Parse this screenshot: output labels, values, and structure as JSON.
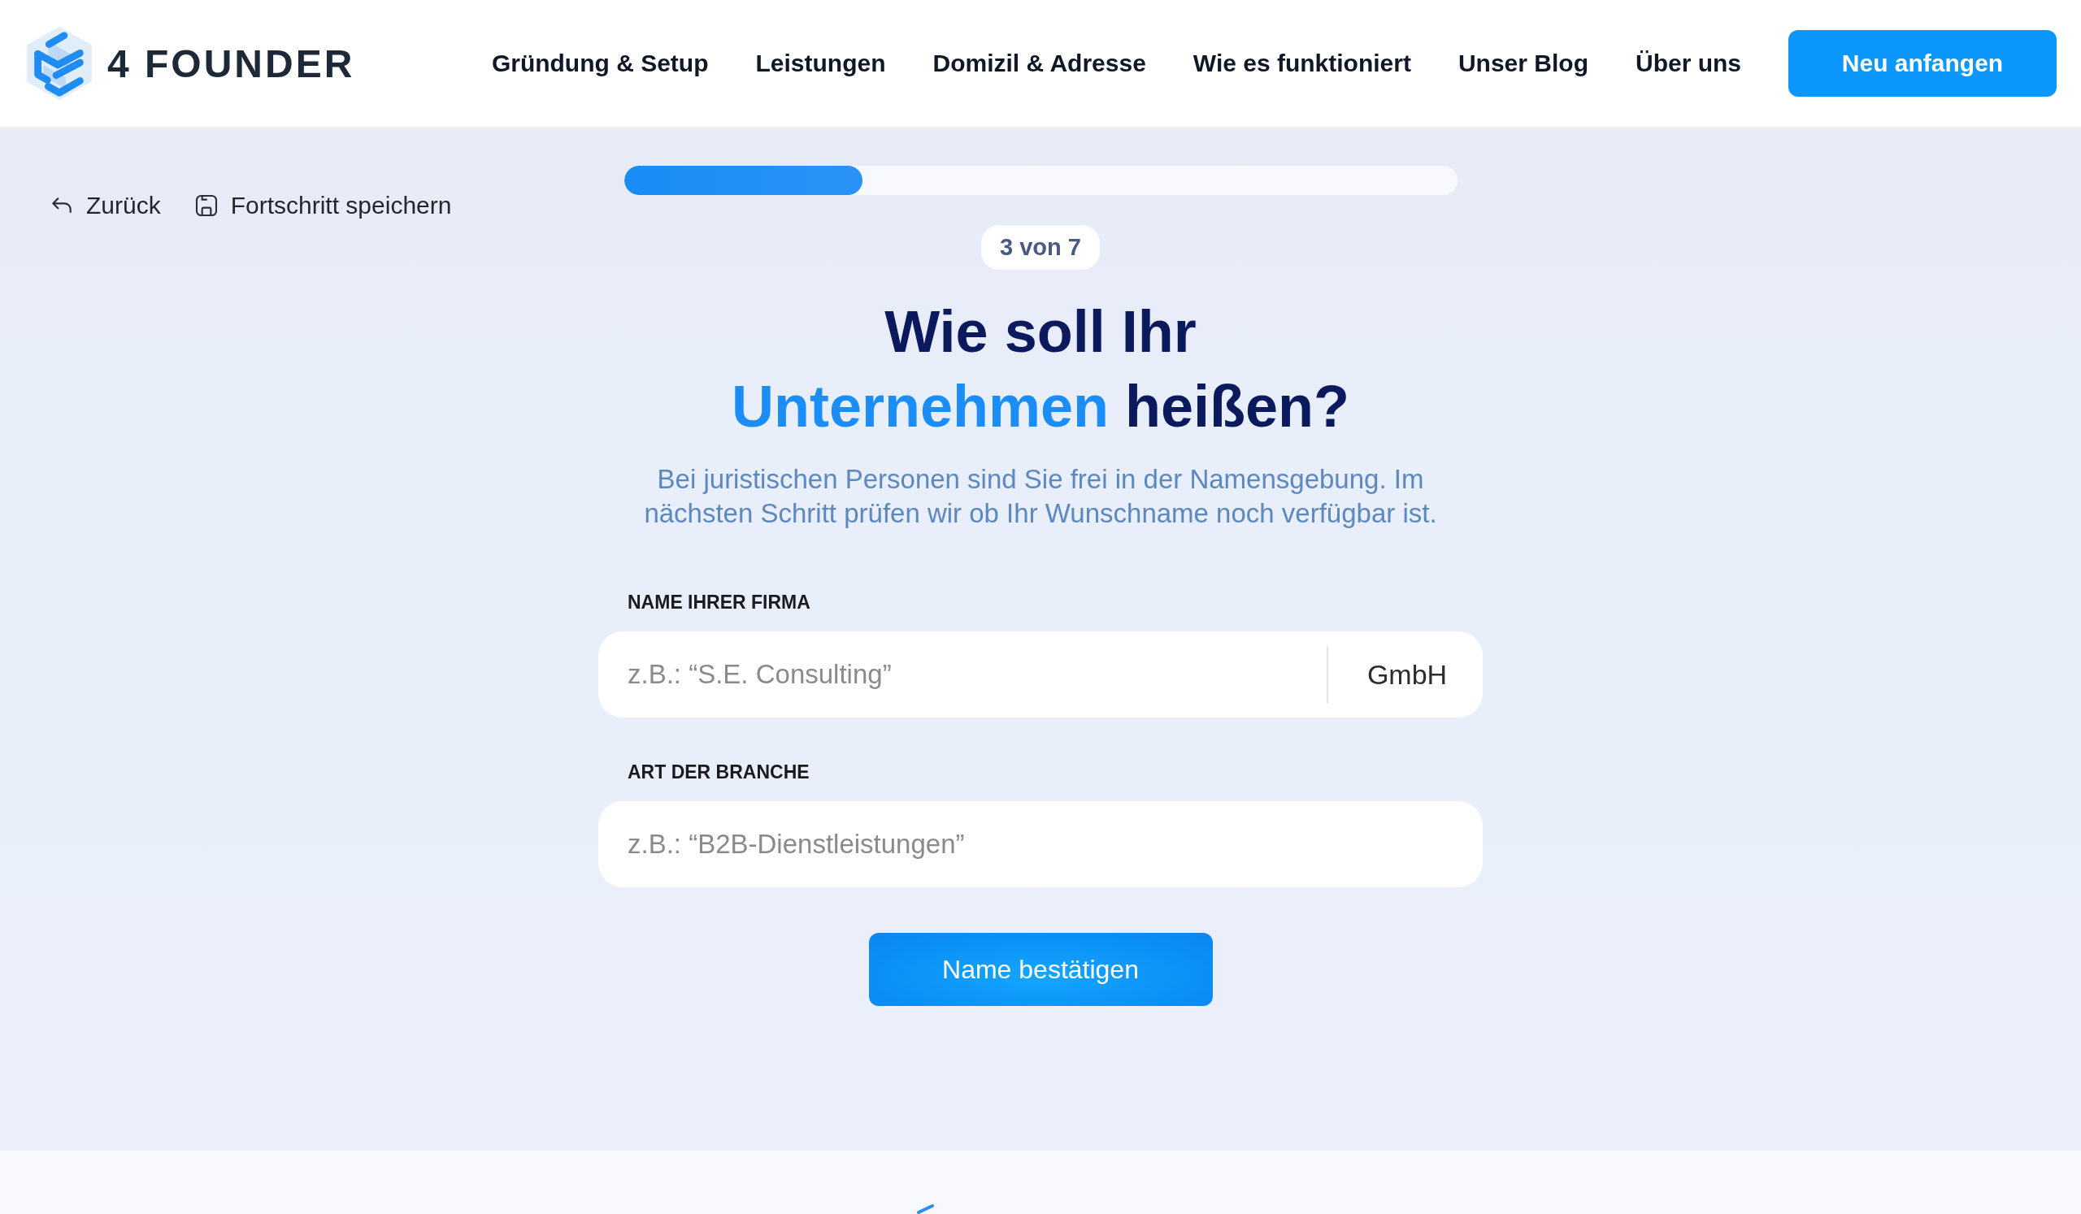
{
  "header": {
    "logo_text": "4 FOUNDER",
    "nav": [
      "Gründung & Setup",
      "Leistungen",
      "Domizil & Adresse",
      "Wie es funktioniert",
      "Unser Blog",
      "Über uns"
    ],
    "cta": "Neu anfangen"
  },
  "toolbar": {
    "back": "Zurück",
    "save": "Fortschritt speichern"
  },
  "progress": {
    "level": 0.286,
    "step": "3 von 7"
  },
  "heading": {
    "lines": [
      [
        {
          "text": "Wie soll Ihr",
          "highlight": false
        }
      ],
      [
        {
          "text": "Unternehmen",
          "highlight": true
        },
        {
          "text": "heißen?",
          "highlight": false
        }
      ]
    ]
  },
  "subtitle": "Bei juristischen Personen sind Sie frei in der Namensgebung. Im nächsten Schritt prüfen wir ob Ihr Wunschname noch verfügbar ist.",
  "form": {
    "fields": [
      {
        "label": "NAME IHRER FIRMA",
        "placeholder": "z.B.: “S.E. Consulting”",
        "suffix": "GmbH"
      },
      {
        "label": "ART DER BRANCHE",
        "placeholder": "z.B.: “B2B-Dienstleistungen”"
      }
    ],
    "submit": "Name bestätigen"
  }
}
